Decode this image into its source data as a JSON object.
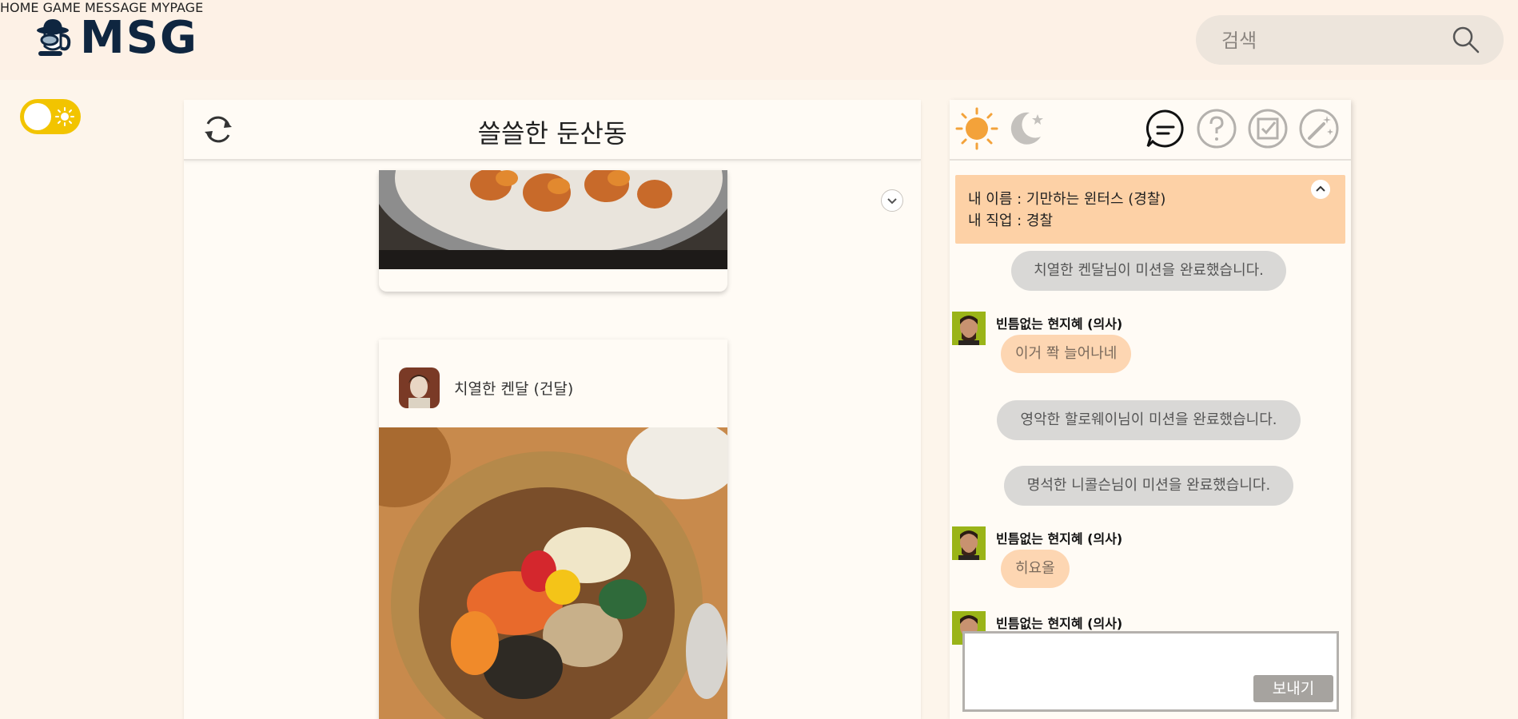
{
  "header": {
    "logo_text": "MSG",
    "nav": [
      "HOME",
      "GAME",
      "MESSAGE",
      "MYPAGE"
    ],
    "search_placeholder": "검색"
  },
  "theme_toggle": {
    "state": "light"
  },
  "feed": {
    "title": "쓸쓸한 둔산동",
    "post": {
      "author": "치열한 켄달 (건달)"
    }
  },
  "chat": {
    "role": {
      "name_line": "내 이름 : 기만하는 윈터스 (경찰)",
      "job_line": "내 직업 : 경찰"
    },
    "messages": {
      "sys1": "치열한 켄달님이 미션을 완료했습니다.",
      "user1_name": "빈틈없는 현지혜 (의사)",
      "user1_text": "이거 쫙 늘어나네",
      "sys2": "영악한 할로웨이님이 미션을 완료했습니다.",
      "sys3": "명석한 니콜슨님이 미션을 완료했습니다.",
      "user2_name": "빈틈없는 현지혜 (의사)",
      "user2_text": "히요올",
      "user3_name": "빈틈없는 현지혜 (의사)"
    },
    "send_label": "보내기"
  },
  "colors": {
    "background": "#fdf5eb",
    "navy": "#0f2640",
    "toggle_yellow": "#f2c400",
    "role_box": "#fdd1a6",
    "bubble": "#fdd6b2",
    "system_bubble": "#d9d8d6"
  }
}
